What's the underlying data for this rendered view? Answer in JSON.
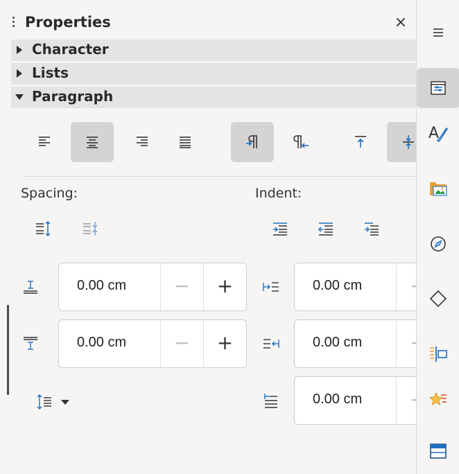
{
  "deck": {
    "title": "Properties",
    "close_glyph": "×",
    "menu_icon": "hamburger-menu-icon"
  },
  "sections": {
    "character": "Character",
    "lists": "Lists",
    "paragraph": "Paragraph"
  },
  "paragraph": {
    "alignment": [
      "align-left",
      "align-center",
      "align-right",
      "justify"
    ],
    "active_alignment": "align-center",
    "direction": [
      "left-to-right",
      "right-to-left"
    ],
    "active_direction": "left-to-right",
    "vertical": [
      "align-top",
      "align-center-vertical"
    ],
    "spacing_label": "Spacing:",
    "indent_label": "Indent:",
    "spacing": {
      "above": "0.00 cm",
      "below": "0.00 cm"
    },
    "indent": {
      "before": "0.00 cm",
      "after": "0.00 cm",
      "first_line": "0.00 cm"
    },
    "minus_glyph": "−",
    "plus_glyph": "+"
  },
  "tabbar": {
    "tabs": [
      "properties",
      "styles",
      "gallery",
      "navigator",
      "shapes",
      "manage-changes",
      "design",
      "page"
    ],
    "active_tab": "properties"
  },
  "colors": {
    "accent_blue": "#1e6fc0",
    "active_bg": "#d6d4d2",
    "section_bg": "#e6e4e2",
    "folder_orange": "#f0a030"
  }
}
